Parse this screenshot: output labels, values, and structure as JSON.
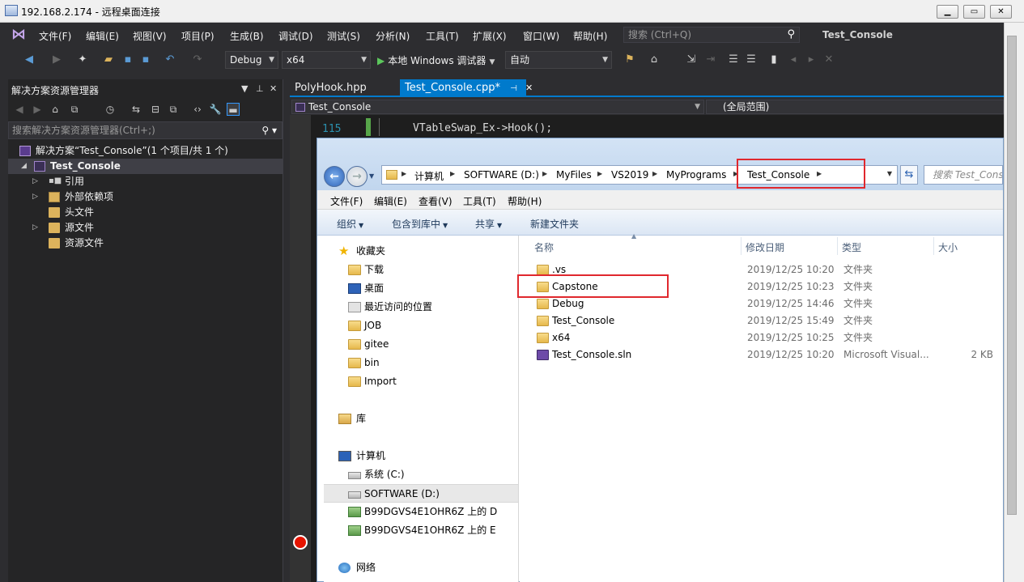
{
  "rdp": {
    "title": "192.168.2.174 - 远程桌面连接",
    "minimize": "▁",
    "restore": "▭",
    "close": "✕"
  },
  "vs": {
    "menu": [
      "文件(F)",
      "编辑(E)",
      "视图(V)",
      "项目(P)",
      "生成(B)",
      "调试(D)",
      "测试(S)",
      "分析(N)",
      "工具(T)",
      "扩展(X)",
      "窗口(W)",
      "帮助(H)"
    ],
    "search_placeholder": "搜索 (Ctrl+Q)",
    "project_name": "Test_Console",
    "toolbar": {
      "config": "Debug",
      "platform": "x64",
      "run_label": "本地 Windows 调试器",
      "run_mode": "自动"
    }
  },
  "solution_explorer": {
    "title": "解决方案资源管理器",
    "search_placeholder": "搜索解决方案资源管理器(Ctrl+;)",
    "tree": [
      {
        "label": "解决方案“Test_Console”(1 个项目/共 1 个)"
      },
      {
        "label": "Test_Console"
      },
      {
        "label": "引用"
      },
      {
        "label": "外部依赖项"
      },
      {
        "label": "头文件"
      },
      {
        "label": "源文件"
      },
      {
        "label": "资源文件"
      }
    ]
  },
  "editor": {
    "tabs": [
      "PolyHook.hpp",
      "Test_Console.cpp*"
    ],
    "tab_pin": "⊣",
    "tab_close": "✕",
    "nav_left": "Test_Console",
    "nav_right": "(全局范围)",
    "line_number": "115",
    "code": "VTableSwap_Ex->Hook();"
  },
  "explorer": {
    "breadcrumb": [
      "计算机",
      "SOFTWARE (D:)",
      "MyFiles",
      "VS2019",
      "MyPrograms",
      "Test_Console"
    ],
    "search_placeholder": "搜索 Test_Console",
    "menu": [
      "文件(F)",
      "编辑(E)",
      "查看(V)",
      "工具(T)",
      "帮助(H)"
    ],
    "commands": [
      "组织",
      "包含到库中",
      "共享",
      "新建文件夹"
    ],
    "nav": [
      {
        "label": "收藏夹"
      },
      {
        "label": "下载"
      },
      {
        "label": "桌面"
      },
      {
        "label": "最近访问的位置"
      },
      {
        "label": "JOB"
      },
      {
        "label": "gitee"
      },
      {
        "label": "bin"
      },
      {
        "label": "Import"
      },
      {
        "label": "库"
      },
      {
        "label": "计算机"
      },
      {
        "label": "系统 (C:)"
      },
      {
        "label": "SOFTWARE (D:)"
      },
      {
        "label": "B99DGVS4E1OHR6Z 上的 D"
      },
      {
        "label": "B99DGVS4E1OHR6Z 上的 E"
      },
      {
        "label": "网络"
      }
    ],
    "columns": [
      "名称",
      "修改日期",
      "类型",
      "大小"
    ],
    "files": [
      {
        "name": ".vs",
        "date": "2019/12/25 10:20",
        "type": "文件夹",
        "size": ""
      },
      {
        "name": "Capstone",
        "date": "2019/12/25 10:23",
        "type": "文件夹",
        "size": ""
      },
      {
        "name": "Debug",
        "date": "2019/12/25 14:46",
        "type": "文件夹",
        "size": ""
      },
      {
        "name": "Test_Console",
        "date": "2019/12/25 15:49",
        "type": "文件夹",
        "size": ""
      },
      {
        "name": "x64",
        "date": "2019/12/25 10:25",
        "type": "文件夹",
        "size": ""
      },
      {
        "name": "Test_Console.sln",
        "date": "2019/12/25 10:20",
        "type": "Microsoft Visual...",
        "size": "2 KB"
      }
    ]
  }
}
